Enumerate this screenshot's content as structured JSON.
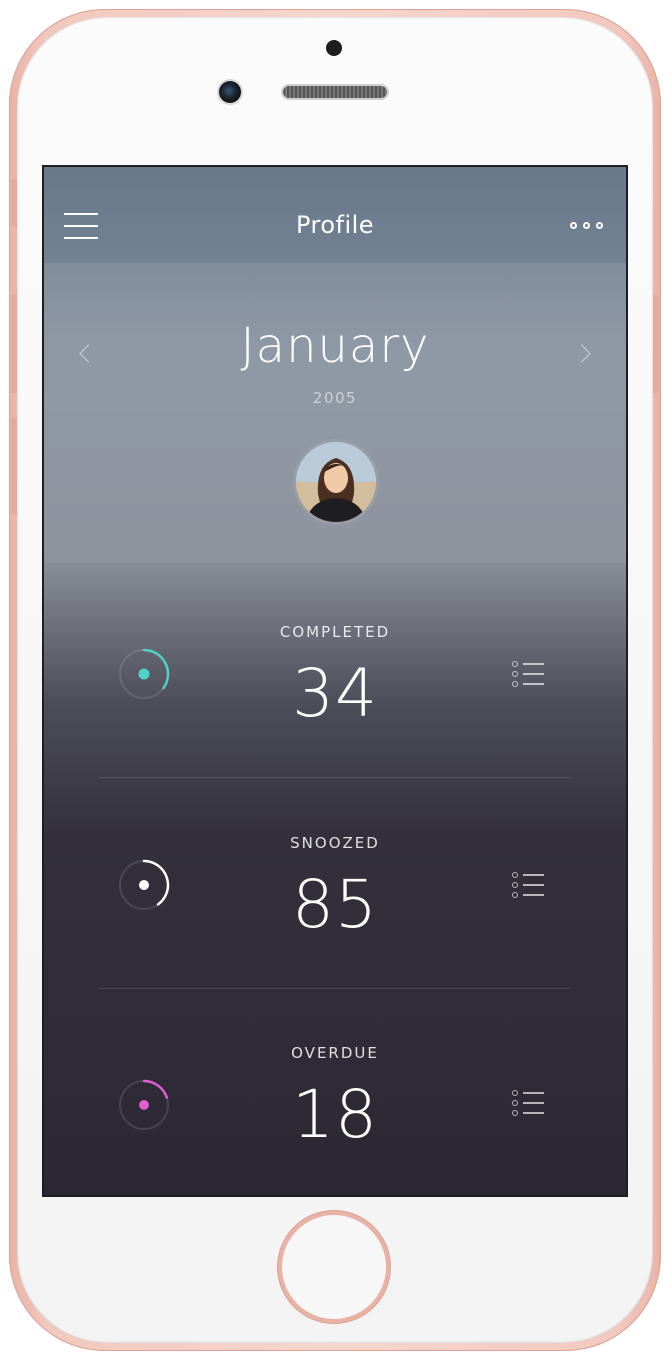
{
  "header": {
    "title": "Profile"
  },
  "profile": {
    "month": "January",
    "year": "2005"
  },
  "stats": [
    {
      "label": "COMPLETED",
      "value": "34",
      "color": "#4fd1c5",
      "progress": 0.35
    },
    {
      "label": "SNOOZED",
      "value": "85",
      "color": "#ffffff",
      "progress": 0.4
    },
    {
      "label": "OVERDUE",
      "value": "18",
      "color": "#e05fd0",
      "progress": 0.2
    }
  ],
  "icons": {
    "menu": "hamburger-menu-icon",
    "more": "more-options-icon",
    "prev": "chevron-left-icon",
    "next": "chevron-right-icon",
    "list": "list-icon"
  },
  "theme": {
    "frame": "#f6d6cd",
    "screen_top": "#6c7c8e",
    "screen_bottom": "#2c2833"
  }
}
